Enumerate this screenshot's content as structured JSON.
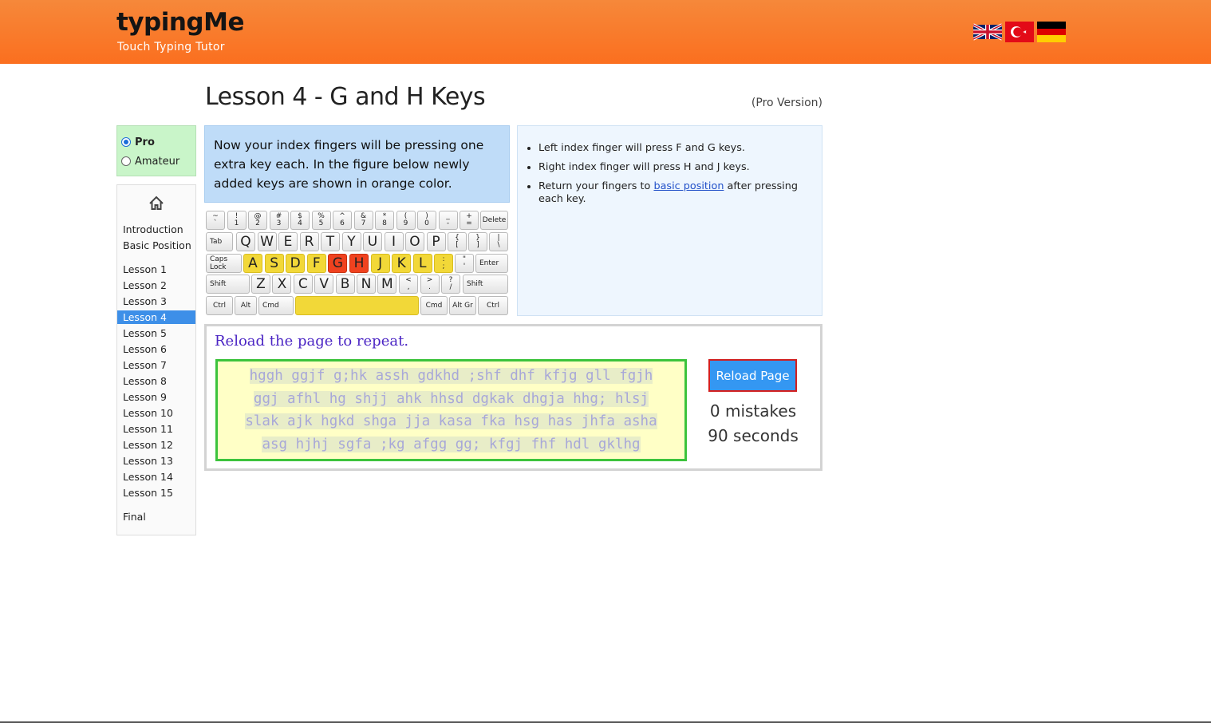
{
  "header": {
    "logo": "typingMe",
    "tagline": "Touch Typing Tutor",
    "flags": [
      "uk-flag-icon",
      "turkey-flag-icon",
      "germany-flag-icon"
    ]
  },
  "page": {
    "title": "Lesson 4 - G and H Keys",
    "version_note": "(Pro Version)"
  },
  "mode": {
    "options": [
      {
        "label": "Pro",
        "selected": true
      },
      {
        "label": "Amateur",
        "selected": false
      }
    ]
  },
  "nav": {
    "home_icon": "home-icon",
    "intro": "Introduction",
    "basic": "Basic Position",
    "lessons": [
      "Lesson 1",
      "Lesson 2",
      "Lesson 3",
      "Lesson 4",
      "Lesson 5",
      "Lesson 6",
      "Lesson 7",
      "Lesson 8",
      "Lesson 9",
      "Lesson 10",
      "Lesson 11",
      "Lesson 12",
      "Lesson 13",
      "Lesson 14",
      "Lesson 15"
    ],
    "active_lesson": "Lesson 4",
    "final": "Final"
  },
  "intro_text": "Now your index fingers will be pressing one extra key each. In the figure below newly added keys are shown in orange color.",
  "tips": {
    "tip1": "Left index finger will press F and G keys.",
    "tip2": "Right index finger will press H and J keys.",
    "tip3_before": "Return your fingers to ",
    "tip3_link": "basic position",
    "tip3_after": " after pressing each key."
  },
  "keyboard": {
    "row1": [
      [
        "~",
        "`"
      ],
      [
        "!",
        "1"
      ],
      [
        "@",
        "2"
      ],
      [
        "#",
        "3"
      ],
      [
        "$",
        "4"
      ],
      [
        "%",
        "5"
      ],
      [
        "^",
        "6"
      ],
      [
        "&",
        "7"
      ],
      [
        "*",
        "8"
      ],
      [
        "(",
        "9"
      ],
      [
        ")",
        "0"
      ],
      [
        "_",
        "-"
      ],
      [
        "+",
        "="
      ]
    ],
    "delete": "Delete",
    "tab": "Tab",
    "row2": [
      "Q",
      "W",
      "E",
      "R",
      "T",
      "Y",
      "U",
      "I",
      "O",
      "P"
    ],
    "row2_sym": [
      [
        "{",
        "["
      ],
      [
        "}",
        "]"
      ],
      [
        "|",
        "\\"
      ]
    ],
    "caps": "Caps Lock",
    "row3": [
      "A",
      "S",
      "D",
      "F",
      "G",
      "H",
      "J",
      "K",
      "L"
    ],
    "row3_sym": [
      [
        ":",
        ";"
      ],
      [
        "\"",
        "'"
      ]
    ],
    "enter": "Enter",
    "shift": "Shift",
    "row4": [
      "Z",
      "X",
      "C",
      "V",
      "B",
      "N",
      "M"
    ],
    "row4_sym": [
      [
        "<",
        ","
      ],
      [
        ">",
        "."
      ],
      [
        "?",
        "/"
      ]
    ],
    "ctrl": "Ctrl",
    "alt": "Alt",
    "cmd": "Cmd",
    "altgr": "Alt Gr",
    "home_keys_color": "#f2d838",
    "new_keys_color": "#f0421f"
  },
  "practice": {
    "reload_msg": "Reload the page to repeat.",
    "lines": [
      "hggh ggjf g;hk assh gdkhd ;shf dhf kfjg gll fgjh",
      "ggj afhl hg shjj ahk hhsd dgkak dhgja hhg; hlsj",
      "slak ajk hgkd shga jja kasa fka hsg has jhfa asha",
      "asg hjhj sgfa ;kg afgg gg; kfgj fhf hdl gklhg"
    ],
    "reload_button": "Reload Page",
    "mistakes": "0 mistakes",
    "seconds": "90 seconds"
  }
}
